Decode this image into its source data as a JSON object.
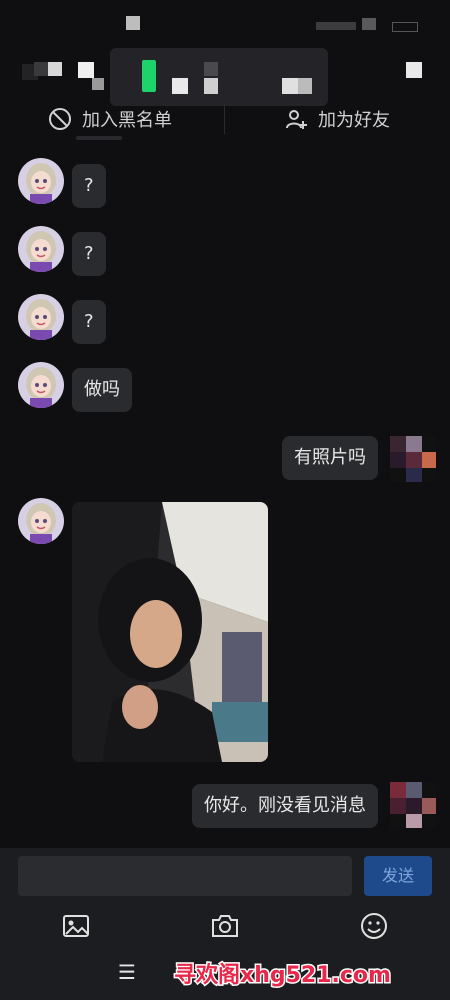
{
  "contact_actions": {
    "block_label": "加入黑名单",
    "add_friend_label": "加为好友"
  },
  "messages": [
    {
      "side": "left",
      "type": "text",
      "text": "?"
    },
    {
      "side": "left",
      "type": "text",
      "text": "?"
    },
    {
      "side": "left",
      "type": "text",
      "text": "?"
    },
    {
      "side": "left",
      "type": "text",
      "text": "做吗"
    },
    {
      "side": "right",
      "type": "text",
      "text": "有照片吗"
    },
    {
      "side": "left",
      "type": "image"
    },
    {
      "side": "right",
      "type": "text",
      "text": "你好。刚没看见消息"
    }
  ],
  "composer": {
    "input_value": "",
    "send_label": "发送"
  },
  "toolbar_icons": [
    "image-icon",
    "camera-icon",
    "emoji-icon"
  ],
  "watermark": {
    "text": "寻欢阁xhg521.com",
    "color": "#e8284a"
  },
  "colors": {
    "background": "#0f0f11",
    "bubble": "#2a2b2f",
    "send_button": "#1e4a8c",
    "accent_green": "#1fd36b"
  }
}
